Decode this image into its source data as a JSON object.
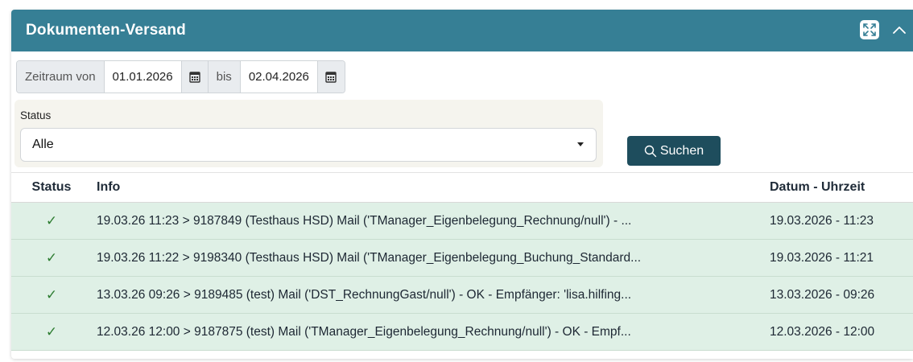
{
  "panel": {
    "title": "Dokumenten-Versand",
    "header_color": "#367f95"
  },
  "filters": {
    "period_from_label": "Zeitraum von",
    "date_from": "01.01.2026",
    "to_label": "bis",
    "date_to": "02.04.2026",
    "status_label": "Status",
    "status_value": "Alle",
    "search_label": "Suchen"
  },
  "table": {
    "columns": [
      "Status",
      "Info",
      "Datum - Uhrzeit"
    ],
    "rows": [
      {
        "status": "✓",
        "info": "19.03.26 11:23 > 9187849 (Testhaus HSD) Mail ('TManager_Eigenbelegung_Rechnung/null') - ...",
        "datetime": "19.03.2026 - 11:23"
      },
      {
        "status": "✓",
        "info": "19.03.26 11:22 > 9198340 (Testhaus HSD) Mail ('TManager_Eigenbelegung_Buchung_Standard...",
        "datetime": "19.03.2026 - 11:21"
      },
      {
        "status": "✓",
        "info": "13.03.26 09:26 > 9189485 (test) Mail ('DST_RechnungGast/null') - OK - Empfänger: 'lisa.hilfing...",
        "datetime": "13.03.2026 - 09:26"
      },
      {
        "status": "✓",
        "info": "12.03.26 12:00 > 9187875 (test) Mail ('TManager_Eigenbelegung_Rechnung/null') - OK - Empf...",
        "datetime": "12.03.2026 - 12:00"
      }
    ]
  },
  "icons": {
    "expand": "expand-arrows-icon",
    "collapse": "chevron-up-icon",
    "calendar": "calendar-icon",
    "search": "magnifier-icon",
    "dropdown": "caret-down-icon",
    "success": "checkmark-icon"
  }
}
